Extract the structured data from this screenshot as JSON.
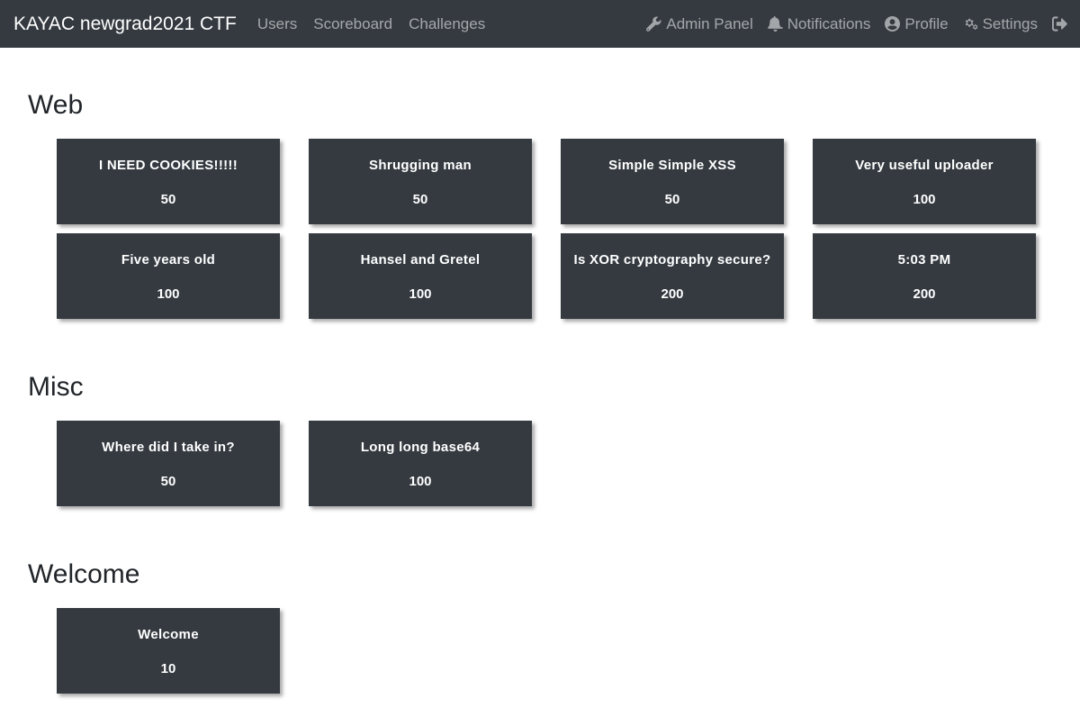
{
  "navbar": {
    "brand": "KAYAC newgrad2021 CTF",
    "left_links": [
      "Users",
      "Scoreboard",
      "Challenges"
    ],
    "admin_panel": "Admin Panel",
    "notifications": "Notifications",
    "profile": "Profile",
    "settings": "Settings",
    "icons": {
      "admin_panel": "wrench-icon",
      "notifications": "bell-icon",
      "profile": "user-circle-icon",
      "settings": "cogs-icon",
      "logout": "sign-out-icon"
    }
  },
  "categories": [
    {
      "name": "Web",
      "challenges": [
        {
          "name": "I NEED COOKIES!!!!!",
          "value": "50"
        },
        {
          "name": "Shrugging man",
          "value": "50"
        },
        {
          "name": "Simple Simple XSS",
          "value": "50"
        },
        {
          "name": "Very useful uploader",
          "value": "100"
        },
        {
          "name": "Five years old",
          "value": "100"
        },
        {
          "name": "Hansel and Gretel",
          "value": "100"
        },
        {
          "name": "Is XOR cryptography secure?",
          "value": "200"
        },
        {
          "name": "5:03 PM",
          "value": "200"
        }
      ]
    },
    {
      "name": "Misc",
      "challenges": [
        {
          "name": "Where did I take in?",
          "value": "50"
        },
        {
          "name": "Long long base64",
          "value": "100"
        }
      ]
    },
    {
      "name": "Welcome",
      "challenges": [
        {
          "name": "Welcome",
          "value": "10"
        }
      ]
    }
  ],
  "colors": {
    "navbar_bg": "#343a40",
    "card_bg": "#343a40",
    "page_bg": "#ffffff"
  }
}
